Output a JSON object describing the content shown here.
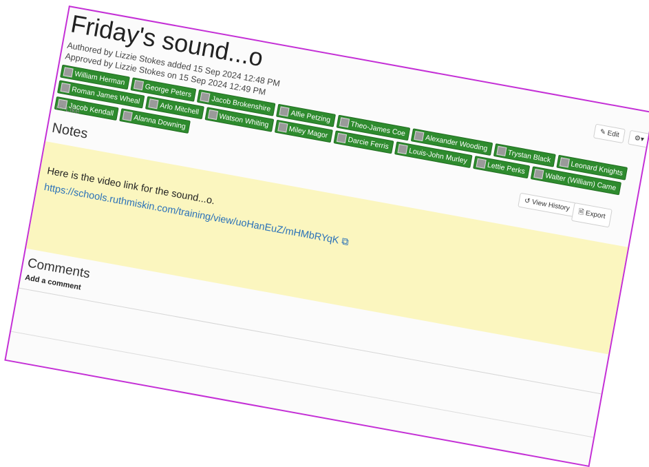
{
  "page": {
    "title": "Friday's sound...o",
    "authored_line": "Authored by Lizzie Stokes added 15 Sep 2024 12:48 PM",
    "approved_line": "Approved by Lizzie Stokes on 15 Sep 2024 12:49 PM",
    "like_label": "Like",
    "notes_heading": "Notes",
    "comments_heading": "Comments",
    "add_comment_label": "Add a comment"
  },
  "buttons": {
    "edit": "Edit",
    "view_history": "View History",
    "export": "Export"
  },
  "people": [
    "William Herman",
    "George Peters",
    "Jacob Brokenshire",
    "Alfie Petzing",
    "Theo-James Coe",
    "Alexander Wooding",
    "Trystan Black",
    "Leonard Knights",
    "Roman James Wheal",
    "Arlo Mitchell",
    "Watson Whiting",
    "Miley Magor",
    "Darcie Ferris",
    "Louis-John Murley",
    "Lettie Perks",
    "Walter (William) Came",
    "Jacob Kendall",
    "Alanna Downing"
  ],
  "note": {
    "text": "Here is the video link for the sound...o.",
    "link": "https://schools.ruthmiskin.com/training/view/uoHanEuZ/mHMbRYqK"
  },
  "colors": {
    "frame_border": "#c42fd6",
    "chip_green": "#2e8b2e",
    "note_bg": "#fbf6bf",
    "link_blue": "#2a71b8"
  },
  "icons": [
    "thumbs-up-icon",
    "pencil-icon",
    "gear-icon",
    "chevron-down-icon",
    "history-icon",
    "export-icon",
    "external-link-icon",
    "avatar-icon"
  ]
}
